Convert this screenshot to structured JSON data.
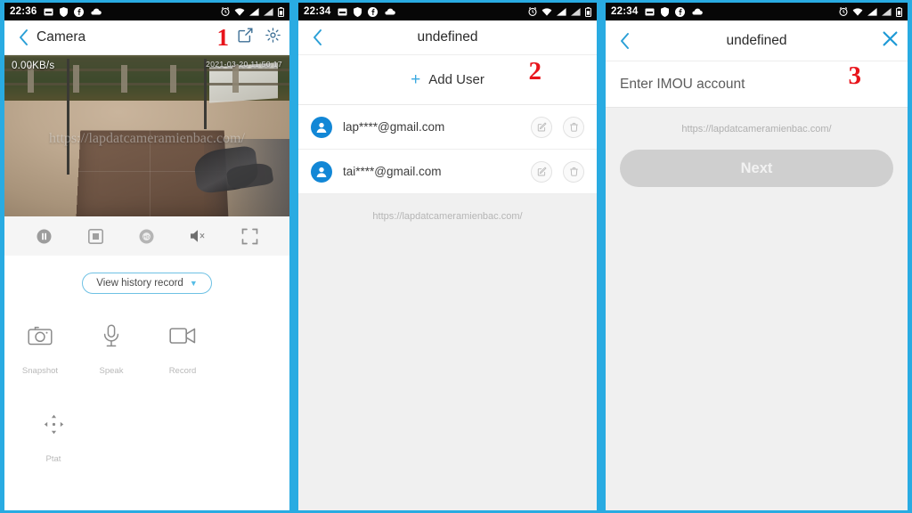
{
  "panel1": {
    "statusbar": {
      "time": "22:36",
      "left_icons": [
        "screenshot-icon",
        "shield-icon",
        "facebook-icon",
        "cloud-icon"
      ],
      "right_icons": [
        "alarm-icon",
        "wifi-icon",
        "signal-icon",
        "signal-2-icon",
        "battery-icon"
      ]
    },
    "header": {
      "back_icon": "back-chevron-icon",
      "title": "Camera",
      "step_number": "1",
      "share_icon": "share-icon",
      "settings_icon": "gear-icon"
    },
    "video": {
      "bitrate": "0.00KB/s",
      "timestamp": "2021-03-20 11:50:17",
      "watermark": "https://lapdatcameramienbac.com/"
    },
    "controls": [
      {
        "name": "pause-button",
        "icon": "pause-circle-icon"
      },
      {
        "name": "stop-button",
        "icon": "stop-square-icon"
      },
      {
        "name": "quality-button",
        "icon": "hd-quality-icon"
      },
      {
        "name": "mute-button",
        "icon": "speaker-mute-icon"
      },
      {
        "name": "fullscreen-button",
        "icon": "fullscreen-icon"
      }
    ],
    "history_button": {
      "label": "View history record",
      "caret": "▼"
    },
    "functions": [
      {
        "label": "Snapshot",
        "icon": "camera-icon"
      },
      {
        "label": "Speak",
        "icon": "microphone-icon"
      },
      {
        "label": "Record",
        "icon": "video-record-icon"
      }
    ],
    "ptz": {
      "label": "Ptat",
      "icon": "ptz-direction-icon"
    }
  },
  "panel2": {
    "statusbar": {
      "time": "22:34",
      "left_icons": [
        "screenshot-icon",
        "shield-icon",
        "facebook-icon",
        "cloud-icon"
      ],
      "right_icons": [
        "alarm-icon",
        "wifi-icon",
        "signal-icon",
        "signal-2-icon",
        "battery-icon"
      ]
    },
    "header": {
      "back_icon": "back-chevron-icon",
      "title": "undefined"
    },
    "add_user": {
      "label": "Add User",
      "plus": "+",
      "step_number": "2"
    },
    "users": [
      {
        "email": "lap****@gmail.com",
        "edit_icon": "edit-icon",
        "delete_icon": "trash-icon"
      },
      {
        "email": "tai****@gmail.com",
        "edit_icon": "edit-icon",
        "delete_icon": "trash-icon"
      }
    ],
    "watermark": "https://lapdatcameramienbac.com/"
  },
  "panel3": {
    "statusbar": {
      "time": "22:34",
      "left_icons": [
        "screenshot-icon",
        "shield-icon",
        "facebook-icon",
        "cloud-icon"
      ],
      "right_icons": [
        "alarm-icon",
        "wifi-icon",
        "signal-icon",
        "signal-2-icon",
        "battery-icon"
      ]
    },
    "header": {
      "back_icon": "back-chevron-icon",
      "title": "undefined",
      "close_icon": "close-icon"
    },
    "account_input": {
      "value": "",
      "placeholder": "Enter IMOU account",
      "step_number": "3"
    },
    "watermark": "https://lapdatcameramienbac.com/",
    "next_button": {
      "label": "Next"
    }
  },
  "theme": {
    "accent": "#29abe2",
    "step_red": "#e8141b",
    "avatar_blue": "#1287d6",
    "disabled_gray": "#cfcfcf"
  }
}
